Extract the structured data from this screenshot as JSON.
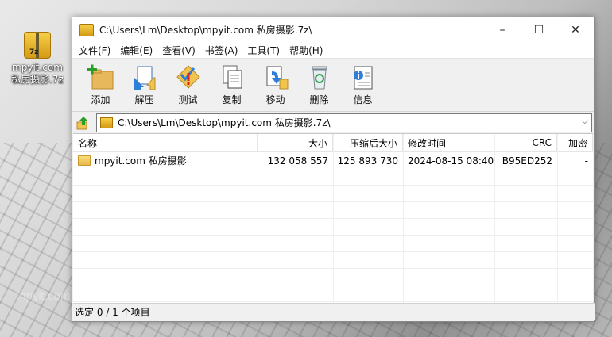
{
  "desktop": {
    "icon_label": "mpyit.com\n私房摄影.7z",
    "icon_label_line1": "mpyit.com",
    "icon_label_line2": "私房摄影.7z",
    "watermark_text": "mpyit.com"
  },
  "window": {
    "title": "C:\\Users\\Lm\\Desktop\\mpyit.com 私房摄影.7z\\",
    "controls": {
      "minimize": "–",
      "maximize": "☐",
      "close": "✕"
    }
  },
  "menu": [
    "文件(F)",
    "编辑(E)",
    "查看(V)",
    "书签(A)",
    "工具(T)",
    "帮助(H)"
  ],
  "toolbar": {
    "add": "添加",
    "extract": "解压",
    "test": "测试",
    "copy": "复制",
    "move": "移动",
    "delete": "删除",
    "info": "信息"
  },
  "address": {
    "path": "C:\\Users\\Lm\\Desktop\\mpyit.com 私房摄影.7z\\"
  },
  "list": {
    "columns": {
      "name": "名称",
      "size": "大小",
      "packed": "压缩后大小",
      "modified": "修改时间",
      "crc": "CRC",
      "encrypted": "加密"
    },
    "rows": [
      {
        "name": "mpyit.com 私房摄影",
        "size": "132 058 557",
        "packed": "125 893 730",
        "modified": "2024-08-15 08:40",
        "crc": "B95ED252",
        "encrypted": "-"
      }
    ]
  },
  "status": {
    "text": "选定 0 / 1 个项目"
  }
}
